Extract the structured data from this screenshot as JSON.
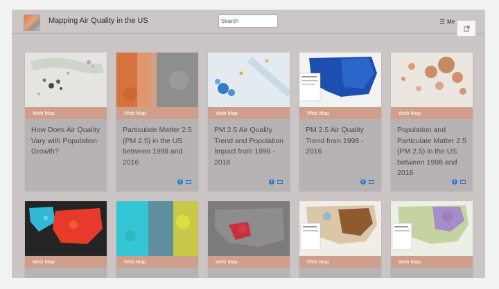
{
  "header": {
    "title": "Mapping Air Quality in the US",
    "search_placeholder": "Search",
    "menu_label": "Me",
    "menu_icon": "hamburger-icon",
    "share_icon": "external-link-icon"
  },
  "card_type_label": "Web Map",
  "row1": [
    {
      "type": "Web Map",
      "title": "How Does Air Quality Vary with Population Growth?"
    },
    {
      "type": "Web Map",
      "title": "Particulate Matter 2.5 (PM 2.5) in the US between 1998 and 2016"
    },
    {
      "type": "Web Map",
      "title": "PM 2.5 Air Quality Trend and Population Impact from 1998 - 2016"
    },
    {
      "type": "Web Map",
      "title": "PM 2.5 Air Quality Trend from 1998 - 2016"
    },
    {
      "type": "Web Map",
      "title": "Population and Particulate Matter 2.5 (PM 2.5) in the US between 1998 and 2016"
    }
  ],
  "row2": [
    {
      "type": "Web Map"
    },
    {
      "type": "Web Map"
    },
    {
      "type": "Web Map"
    },
    {
      "type": "Web Map"
    },
    {
      "type": "Web Map"
    }
  ],
  "colors": {
    "background": "#ccc5c5",
    "ribbon": "#cf9f8b",
    "card": "#b7b2b4",
    "accent": "#2f7bc4"
  }
}
